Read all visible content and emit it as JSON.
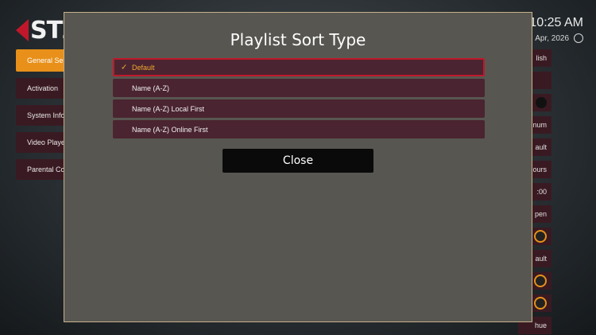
{
  "background": {
    "logo_text": "STZ",
    "clock": {
      "time": "10:25 AM",
      "date": "Apr, 2026"
    },
    "sidebar": {
      "items": [
        {
          "label": "General Se"
        },
        {
          "label": "Activation"
        },
        {
          "label": "System Info"
        },
        {
          "label": "Video Playe"
        },
        {
          "label": "Parental Co"
        }
      ]
    },
    "right_items": [
      {
        "label": "lish"
      },
      {
        "label": ""
      },
      {
        "label": ""
      },
      {
        "label": "num"
      },
      {
        "label": "ault"
      },
      {
        "label": "ours"
      },
      {
        "label": ":00"
      },
      {
        "label": "pen"
      },
      {
        "label": ""
      },
      {
        "label": "ault"
      },
      {
        "label": ""
      },
      {
        "label": ""
      },
      {
        "label": "hue"
      }
    ]
  },
  "dialog": {
    "title": "Playlist Sort Type",
    "options": [
      {
        "label": "Default",
        "selected": true
      },
      {
        "label": "Name (A-Z)",
        "selected": false
      },
      {
        "label": "Name (A-Z) Local First",
        "selected": false
      },
      {
        "label": "Name (A-Z) Online First",
        "selected": false
      }
    ],
    "close_label": "Close"
  },
  "colors": {
    "accent_orange": "#e8901a",
    "selected_border": "#c0182a",
    "option_bg": "#4a2430",
    "dialog_bg": "#585651"
  }
}
